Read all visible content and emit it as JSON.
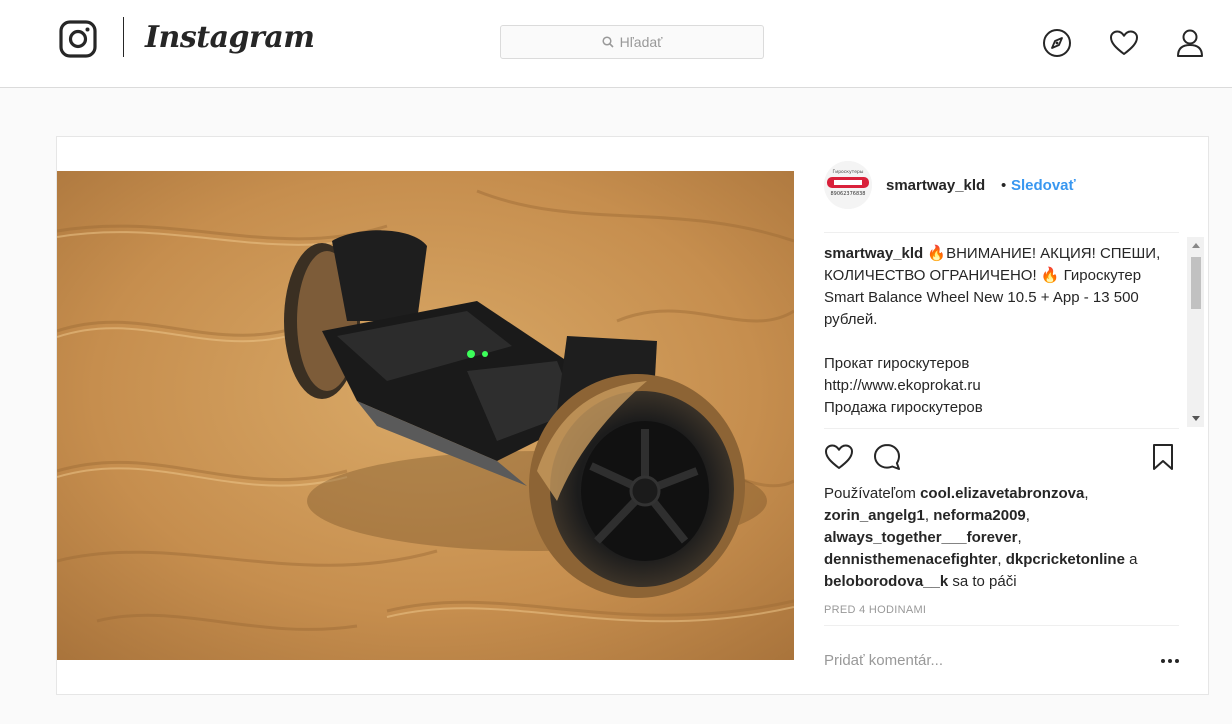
{
  "header": {
    "wordmark": "Instagram",
    "search_placeholder": "Hľadať"
  },
  "post": {
    "username": "smartway_kld",
    "dot": "•",
    "follow_label": "Sledovať",
    "avatar_text": [
      "Гироскутеры",
      "89062376838"
    ],
    "caption": {
      "username": "smartway_kld",
      "text": " 🔥ВНИМАНИЕ! АКЦИЯ! СПЕШИ, КОЛИЧЕСТВО ОГРАНИЧЕНО! 🔥 Гироскутер Smart Balance Wheel New 10.5 + App - 13 500 рублей.\n\nПрокат гироскутеров\nhttp://www.ekoprokat.ru\nПродажа гироскутеров"
    },
    "likes": {
      "prefix": "Používateľom ",
      "users": [
        "cool.elizavetabronzova",
        "zorin_angelg1",
        "neforma2009",
        "always_together___forever",
        "dennisthemenacefighter",
        "dkpcricketonline",
        "beloborodova__k"
      ],
      "sep": ", ",
      "and": " a ",
      "suffix": " sa to páči"
    },
    "timestamp": "PRED 4 HODINAMI",
    "comment_placeholder": "Pridať komentár..."
  },
  "colors": {
    "link": "#3897f0",
    "text": "#262626",
    "muted": "#999999",
    "border": "#dbdbdb"
  },
  "icons": {
    "logo": "instagram-camera-icon",
    "search": "search-icon",
    "explore": "compass-icon",
    "activity": "heart-icon",
    "profile": "user-icon",
    "like": "heart-outline-icon",
    "comment": "comment-icon",
    "save": "bookmark-icon",
    "options": "more-icon"
  }
}
